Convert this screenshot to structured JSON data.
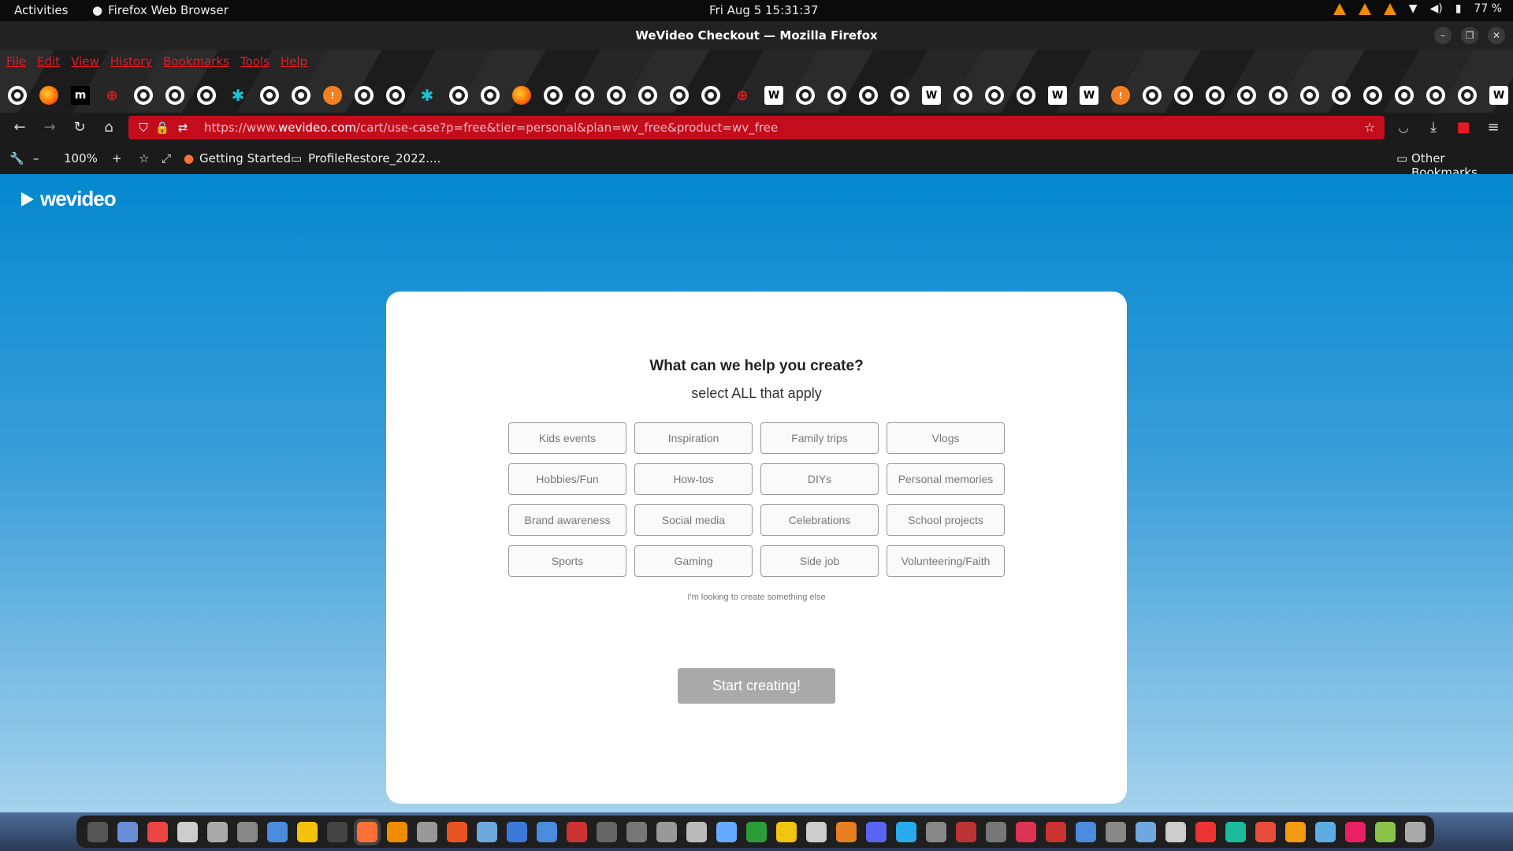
{
  "topbar": {
    "activities": "Activities",
    "app_name": "Firefox Web Browser",
    "clock": "Fri Aug 5  15:31:37",
    "battery": "77 %"
  },
  "window": {
    "title": "WeVideo Checkout — Mozilla Firefox"
  },
  "menu": [
    "File",
    "Edit",
    "View",
    "History",
    "Bookmarks",
    "Tools",
    "Help"
  ],
  "bookmark_icons": [
    "gh",
    "ff",
    "m",
    "r",
    "gh",
    "gh",
    "gh",
    "x",
    "gh",
    "gh",
    "o",
    "gh",
    "gh",
    "x",
    "gh",
    "gh",
    "ff",
    "gh",
    "gh",
    "gh",
    "gh",
    "gh",
    "gh",
    "r",
    "w",
    "gh",
    "gh",
    "gh",
    "gh",
    "w",
    "gh",
    "gh",
    "gh",
    "w",
    "w",
    "o",
    "gh",
    "gh",
    "gh",
    "gh",
    "gh",
    "gh",
    "gh",
    "gh",
    "gh",
    "gh",
    "gh",
    "w",
    "gh"
  ],
  "url": {
    "prefix": "https://www.",
    "domain": "wevideo.com",
    "path": "/cart/use-case?p=free&tier=personal&plan=wv_free&product=wv_free"
  },
  "bookmarks_bar": {
    "zoom": "100%",
    "getting_started": "Getting Started",
    "profile_folder": "ProfileRestore_2022....",
    "other": "Other Bookmarks"
  },
  "page": {
    "logo": "wevideo",
    "question": "What can we help you create?",
    "instruction": "select ALL that apply",
    "options": [
      "Kids events",
      "Inspiration",
      "Family trips",
      "Vlogs",
      "Hobbies/Fun",
      "How-tos",
      "DIYs",
      "Personal memories",
      "Brand awareness",
      "Social media",
      "Celebrations",
      "School projects",
      "Sports",
      "Gaming",
      "Side job",
      "Volunteering/Faith"
    ],
    "other_link": "I'm looking to create something else",
    "start_button": "Start creating!"
  },
  "dock_colors": [
    "#555",
    "#6a8fd8",
    "#e44",
    "#ccc",
    "#aaa",
    "#888",
    "#4a8bdc",
    "#f4c20d",
    "#444",
    "#ff7139",
    "#f08c00",
    "#999",
    "#e95420",
    "#6fa8dc",
    "#3c78d8",
    "#4a8bdc",
    "#c33",
    "#666",
    "#777",
    "#999",
    "#bbb",
    "#6af",
    "#2a9d3a",
    "#f1c40f",
    "#ccc",
    "#e67e22",
    "#5865f2",
    "#2aabee",
    "#888",
    "#b33",
    "#777",
    "#d35",
    "#c33",
    "#4a8bdc",
    "#888",
    "#6fa8dc",
    "#ccc",
    "#e33",
    "#1abc9c",
    "#e74c3c",
    "#f39c12",
    "#5dade2",
    "#e91e63",
    "#8bc34a",
    "#aaa"
  ]
}
